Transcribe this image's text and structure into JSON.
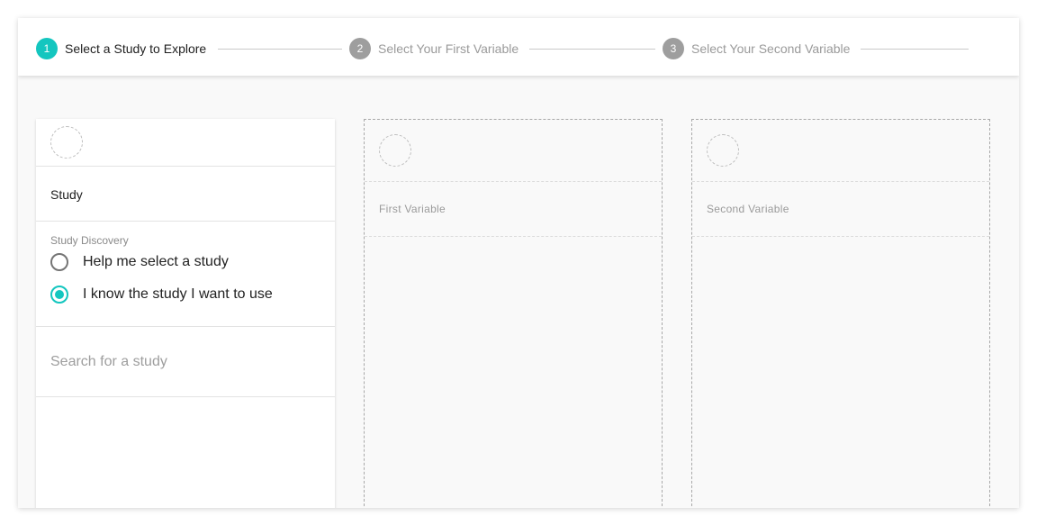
{
  "stepper": {
    "steps": [
      {
        "number": "1",
        "label": "Select a Study to Explore",
        "active": true
      },
      {
        "number": "2",
        "label": "Select Your First Variable",
        "active": false
      },
      {
        "number": "3",
        "label": "Select Your Second Variable",
        "active": false
      }
    ]
  },
  "study_panel": {
    "title": "Study",
    "discovery_label": "Study Discovery",
    "options": [
      {
        "label": "Help me select a study",
        "checked": false
      },
      {
        "label": "I know the study I want to use",
        "checked": true
      }
    ],
    "search_placeholder": "Search for a study"
  },
  "first_variable_panel": {
    "label": "First Variable"
  },
  "second_variable_panel": {
    "label": "Second Variable"
  },
  "colors": {
    "accent": "#14c6bf",
    "inactive_step": "#9e9e9e",
    "background": "#f9f9f9"
  }
}
